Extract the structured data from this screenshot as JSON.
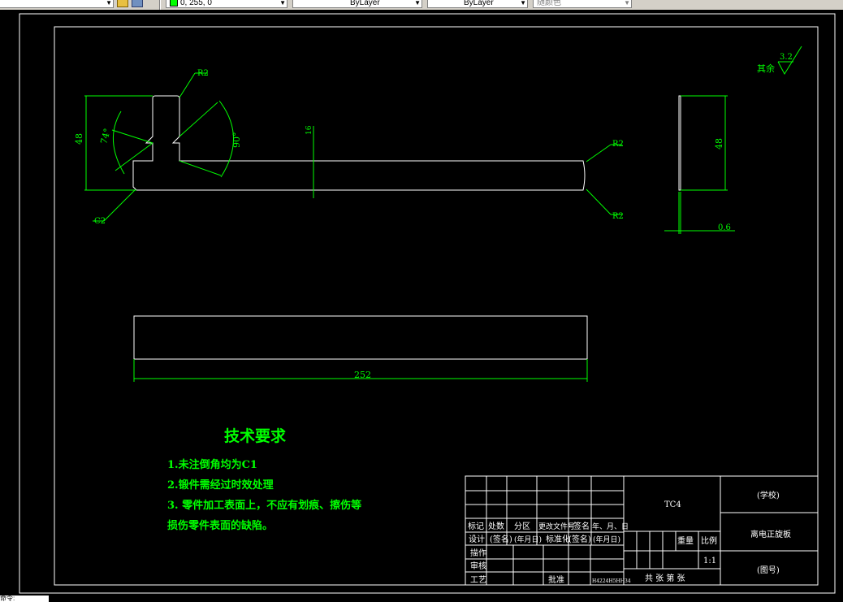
{
  "toolbar": {
    "color_value": "0, 255, 0",
    "linetype_value": "ByLayer",
    "lineweight_value": "ByLayer",
    "plotstyle_value": "随颜色"
  },
  "status": {
    "command_prompt": "命令:"
  },
  "colors": {
    "background": "#000000",
    "geometry": "#ffffff",
    "annotation": "#00ff00"
  },
  "drawing": {
    "dims": {
      "r_top": "R2",
      "r_right_top": "R2",
      "r_right_bottom": "R2",
      "chamfer": "C2",
      "height_left": "48",
      "angle_left": "74°",
      "angle_right": "90°",
      "thickness_mid": "16",
      "height_side": "48",
      "side_thickness": "0.6",
      "length_bottom": "252"
    },
    "roughness": {
      "label": "其余",
      "value": "3.2"
    }
  },
  "tech_req": {
    "title": "技术要求",
    "items": [
      "1.未注倒角均为C1",
      "2.锻件需经过时效处理",
      "3. 零件加工表面上，不应有划痕、擦伤等",
      "损伤零件表面的缺陷。"
    ]
  },
  "title_block": {
    "material": "TC4",
    "school": "(学校)",
    "part_name": "离电正旋板",
    "drawing_no": "(图号)",
    "row_headers": [
      "标记",
      "处数",
      "分区",
      "更改文件号",
      "签名",
      "年、月、日"
    ],
    "design": "设计",
    "sign": "(签名)",
    "date": "(年月日)",
    "standardize": "标准化",
    "sign2": "(签名)",
    "date2": "(年月日)",
    "drafting": "描作",
    "review": "审核",
    "process": "工艺",
    "approve": "批准",
    "weight": "重量",
    "scale_label": "比例",
    "scale": "1:1",
    "sheets": "共   张   第   张",
    "stamp": "H4224H5HH34"
  }
}
